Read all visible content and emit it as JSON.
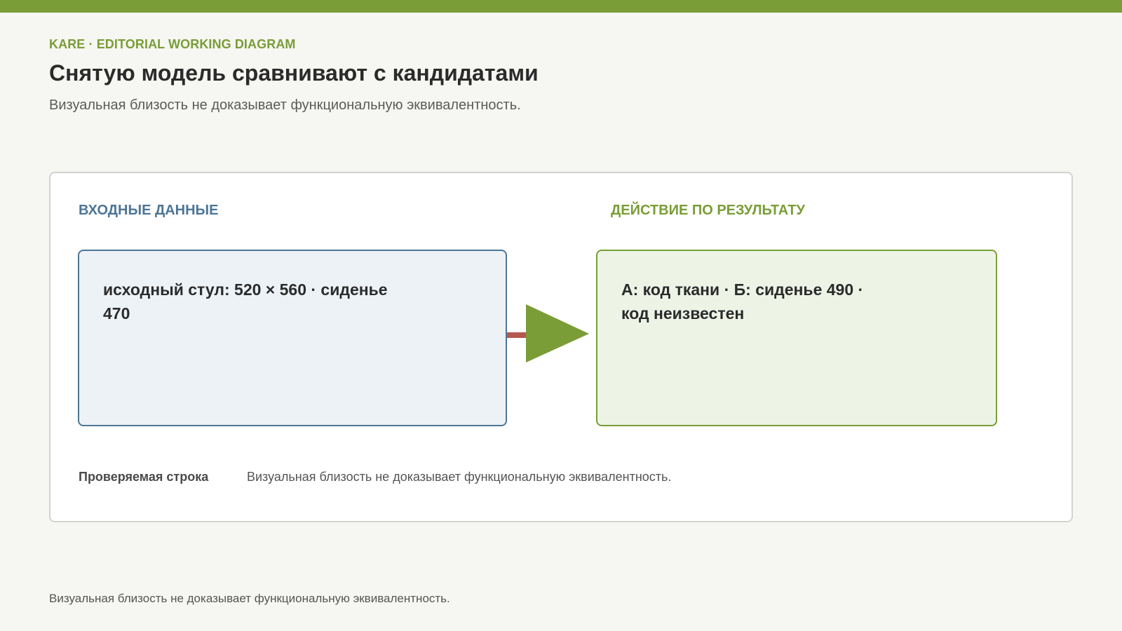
{
  "header": {
    "eyebrow": "KARE · EDITORIAL WORKING DIAGRAM",
    "title": "Снятую модель сравнивают с кандидатами",
    "subtitle": "Визуальная близость не доказывает функциональную эквивалентность."
  },
  "diagram": {
    "input": {
      "label": "ВХОДНЫЕ ДАННЫЕ",
      "text": "исходный стул: 520 × 560 · сиденье 470"
    },
    "action": {
      "label": "ДЕЙСТВИЕ ПО РЕЗУЛЬТАТУ",
      "text": "А: код ткани · Б: сиденье 490 · код неизвестен"
    },
    "check": {
      "label": "Проверяемая строка",
      "text": "Визуальная близость не доказывает функциональную эквивалентность."
    }
  },
  "footer": {
    "note": "Визуальная близость не доказывает функциональную эквивалентность."
  },
  "colors": {
    "accent_green": "#7a9d37",
    "accent_blue": "#4d7696",
    "connector_red": "#b5584e",
    "background": "#f6f6f2"
  }
}
